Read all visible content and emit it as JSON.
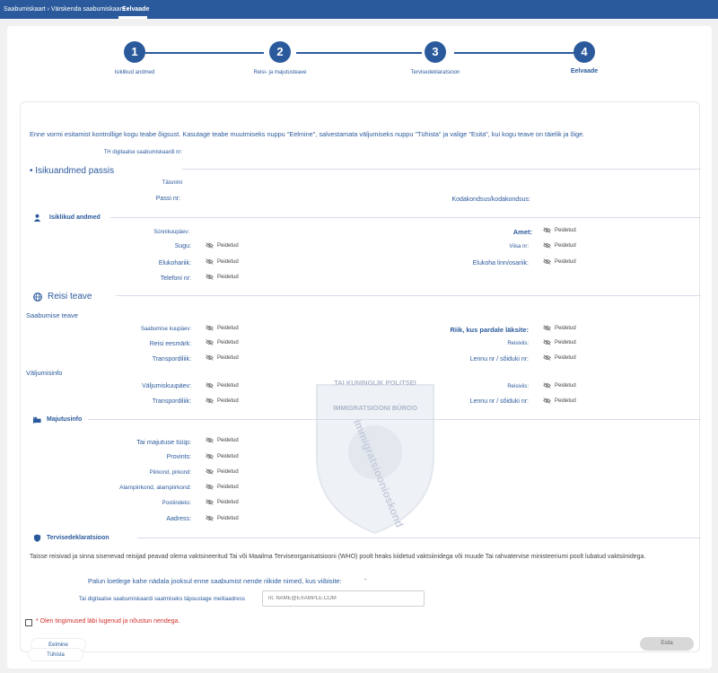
{
  "topbar": {
    "breadcrumb": "Saabumiskaart › Värskenda saabumiskaarti ›",
    "current": "Eelvaade"
  },
  "steps": [
    {
      "number": "1",
      "label": "Isiklikud andmed"
    },
    {
      "number": "2",
      "label": "Reisi- ja majutusteave"
    },
    {
      "number": "3",
      "label": "Tervisedeklaratsioon"
    },
    {
      "number": "4",
      "label": "Eelvaade"
    }
  ],
  "intro": "Enne vormi esitamist kontrollige kogu teabe õigsust. Kasutage teabe muutmiseks nuppu \"Eelmine\", salvestamata väljumiseks nuppu \"Tühista\" ja valige \"Esita\", kui kogu teave on täielik ja õige.",
  "hidden_value": "Peidetud",
  "th_card_label": "TH digitaalse saabumiskaardi nr:",
  "passport": {
    "heading": "• Isikuandmed passis",
    "full_name": "Täisnimi",
    "passport_no": "Passi nr:",
    "nationality": "Kodakondsus/kodakondsus:"
  },
  "personal": {
    "heading": "Isiklikud andmed",
    "birth_date": "Sünnikuupäev:",
    "occupation": "Amet:",
    "gender": "Sugu:",
    "visa": "Viisa nr:",
    "residence_country": "Elukohariik:",
    "residence_city": "Elukoha linn/osariik:",
    "phone": "Telefoni nr:"
  },
  "travel": {
    "heading": "Reisi teave",
    "arrival_heading": "Saabumise teave",
    "arrival_date": "Saabumise kuupäev:",
    "boarding_country": "Riik, kus pardale läksite:",
    "purpose": "Reisi eesmärk:",
    "arrival_trip": "Reisiviis:",
    "transport": "Transpordiliik:",
    "flight_no": "Lennu nr / sõiduki nr:",
    "departure_heading": "Väljumisinfo",
    "departure_date": "Väljumiskuupäev:",
    "departure_trip": "Reisiviis:",
    "departure_transport": "Transpordiliik:",
    "departure_flight": "Lennu nr / sõiduki nr:"
  },
  "accommodation": {
    "heading": "Majutusinfo",
    "type": "Tai majutuse tüüp:",
    "province": "Provints:",
    "district": "Piirkond, pirkond:",
    "subdistrict": "Alampiirkond, alampiirkond:",
    "postcode": "Postiindeks:",
    "address": "Aadress:"
  },
  "health": {
    "heading": "Tervisedeklaratsioon",
    "text": "Taisse reisivad ja sinna sisenevad reisijad peavad olema vaktsineeritud Tai või Maailma Terviseorganisatsiooni (WHO) poolt heaks kiidetud vaktsiinidega või muude Tai rahvatervise ministeeriumi poolt lubatud vaktsiinidega.",
    "countries_question": "Palun loetlege kahe nädala jooksul enne saabumist nende riikide nimed, kus viibisite:",
    "countries_value": "-",
    "email_label": "Tai digitaalse saabumiskaardi saatmiseks täpsustage meiliaadress",
    "email_placeholder": "nt. NAME@EXAMPLE.COM"
  },
  "watermark": {
    "line1": "TAI KUNINGLIK POLITSEI",
    "line2": "IMMIGRATSIOONI BÜROO",
    "line3": "Immigratsioonioskond"
  },
  "consent": "* Olen tingimused läbi lugenud ja nõustun nendega.",
  "buttons": {
    "previous": "Eelmine",
    "submit": "Esita",
    "cancel": "Tühista"
  },
  "colors": {
    "primary": "#2b5a9c",
    "error": "#d0312d"
  }
}
